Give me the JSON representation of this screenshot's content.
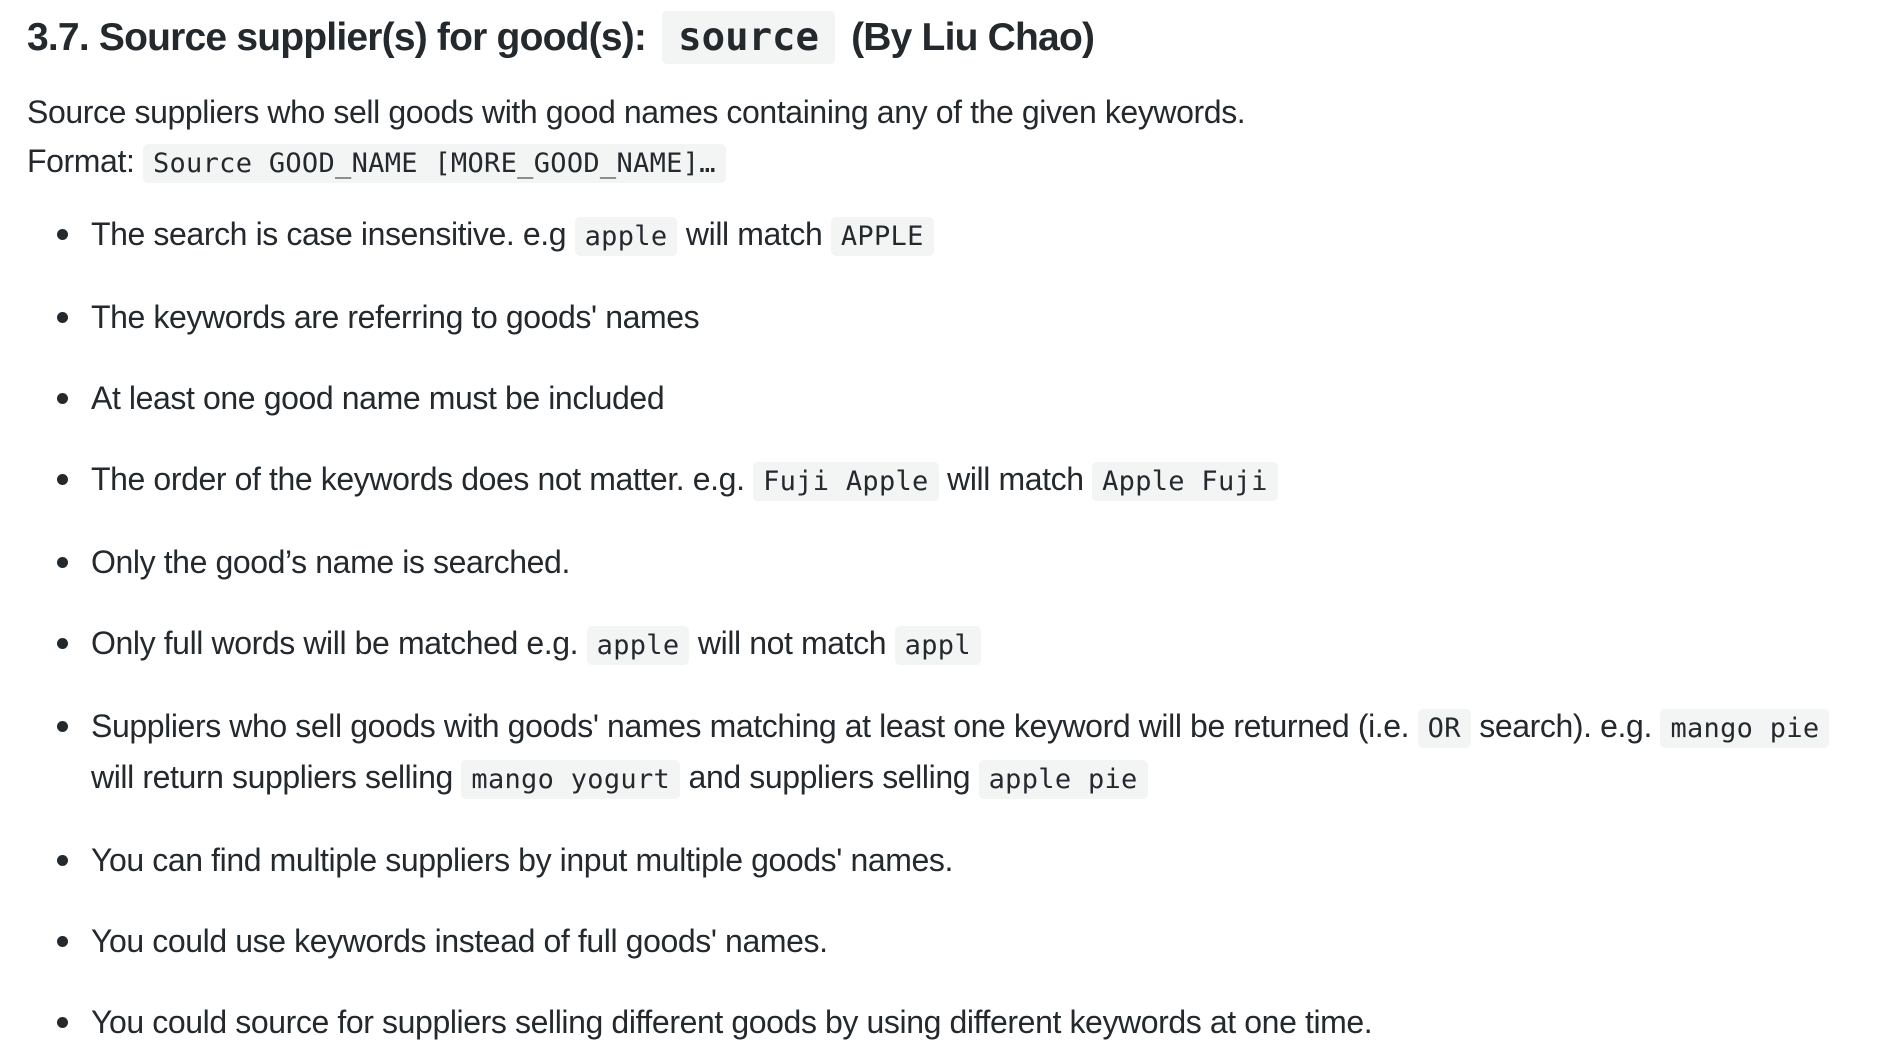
{
  "heading": {
    "prefix": "3.7. Source supplier(s) for good(s): ",
    "command": "source",
    "suffix": " (By Liu Chao)"
  },
  "description": {
    "summary": "Source suppliers who sell goods with good names containing any of the given keywords.",
    "format_label": "Format: ",
    "format_code": "Source GOOD_NAME [MORE_GOOD_NAME]…"
  },
  "rules": [
    {
      "parts": [
        {
          "text": "The search is case insensitive. e.g "
        },
        {
          "code": "apple"
        },
        {
          "text": " will match "
        },
        {
          "code": "APPLE"
        }
      ]
    },
    {
      "parts": [
        {
          "text": "The keywords are referring to goods' names"
        }
      ]
    },
    {
      "parts": [
        {
          "text": "At least one good name must be included"
        }
      ]
    },
    {
      "parts": [
        {
          "text": "The order of the keywords does not matter. e.g. "
        },
        {
          "code": "Fuji Apple"
        },
        {
          "text": " will match "
        },
        {
          "code": "Apple Fuji"
        }
      ]
    },
    {
      "parts": [
        {
          "text": "Only the good’s name is searched."
        }
      ]
    },
    {
      "parts": [
        {
          "text": "Only full words will be matched e.g. "
        },
        {
          "code": "apple"
        },
        {
          "text": " will not match "
        },
        {
          "code": "appl"
        }
      ]
    },
    {
      "parts": [
        {
          "text": "Suppliers who sell goods with goods' names matching at least one keyword will be returned (i.e. "
        },
        {
          "code": "OR"
        },
        {
          "text": " search). e.g. "
        },
        {
          "code": "mango pie"
        },
        {
          "text": " will return suppliers selling "
        },
        {
          "code": "mango yogurt"
        },
        {
          "text": " and suppliers selling "
        },
        {
          "code": "apple pie"
        }
      ]
    },
    {
      "parts": [
        {
          "text": "You can find multiple suppliers by input multiple goods' names."
        }
      ]
    },
    {
      "parts": [
        {
          "text": "You could use keywords instead of full goods' names."
        }
      ]
    },
    {
      "parts": [
        {
          "text": "You could source for suppliers selling different goods by using different keywords at one time."
        }
      ]
    }
  ]
}
